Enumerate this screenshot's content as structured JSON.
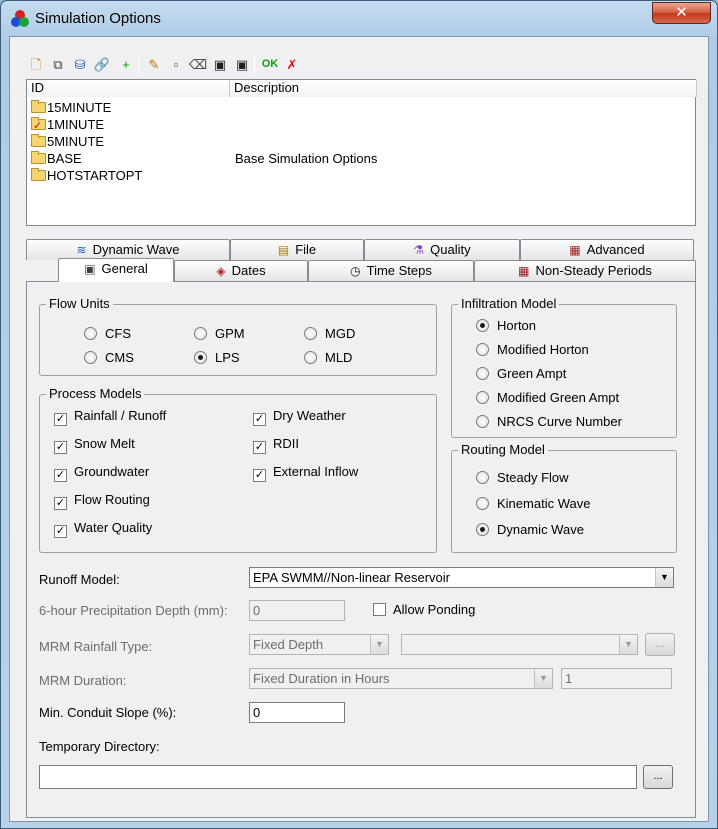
{
  "window": {
    "title": "Simulation Options",
    "close_label": "✕"
  },
  "toolbar": {
    "buttons": [
      {
        "name": "new-icon",
        "glyph": "🗋",
        "color": "#c08000"
      },
      {
        "name": "copy-icon",
        "glyph": "⧉",
        "color": "#404040"
      },
      {
        "name": "database-icon",
        "glyph": "⛁",
        "color": "#2060c0"
      },
      {
        "name": "link-icon",
        "glyph": "🔗",
        "color": "#404040"
      },
      {
        "name": "add-item-icon",
        "glyph": "+",
        "color": "#10a010"
      },
      {
        "name": "edit-pencil-icon",
        "glyph": "✎",
        "color": "#c07000"
      },
      {
        "name": "edit-window-icon",
        "glyph": "▫",
        "color": "#404040"
      },
      {
        "name": "eraser-icon",
        "glyph": "⌫",
        "color": "#404040"
      },
      {
        "name": "save-icon",
        "glyph": "▣",
        "color": "#202020"
      },
      {
        "name": "save-as-icon",
        "glyph": "▣",
        "color": "#202020"
      },
      {
        "name": "ok-icon",
        "glyph": "OK",
        "color": "#10a010"
      },
      {
        "name": "cancel-icon",
        "glyph": "✗",
        "color": "#e01010"
      }
    ]
  },
  "list": {
    "columns": [
      "ID",
      "Description"
    ],
    "rows": [
      {
        "id": "15MINUTE",
        "description": "",
        "checked": false
      },
      {
        "id": "1MINUTE",
        "description": "",
        "checked": true
      },
      {
        "id": "5MINUTE",
        "description": "",
        "checked": false
      },
      {
        "id": "BASE",
        "description": "Base Simulation Options",
        "checked": false
      },
      {
        "id": "HOTSTARTOPT",
        "description": "",
        "checked": false
      }
    ]
  },
  "tabs": {
    "back_row": [
      {
        "label": "Dynamic Wave",
        "icon": "wave-icon",
        "glyph": "≋",
        "color": "#1a60c0"
      },
      {
        "label": "File",
        "icon": "file-icon",
        "glyph": "▤",
        "color": "#b08000"
      },
      {
        "label": "Quality",
        "icon": "flask-icon",
        "glyph": "⚗",
        "color": "#8040c0"
      },
      {
        "label": "Advanced",
        "icon": "toolbox-icon",
        "glyph": "▦",
        "color": "#a02020"
      }
    ],
    "front_row": [
      {
        "label": "General",
        "icon": "general-icon",
        "glyph": "▣",
        "color": "#404040",
        "active": true
      },
      {
        "label": "Dates",
        "icon": "calendar-icon",
        "glyph": "◈",
        "color": "#b02020",
        "active": false
      },
      {
        "label": "Time Steps",
        "icon": "clock-icon",
        "glyph": "◷",
        "color": "#202020",
        "active": false
      },
      {
        "label": "Non-Steady Periods",
        "icon": "periods-icon",
        "glyph": "▦",
        "color": "#902020",
        "active": false
      }
    ]
  },
  "general": {
    "flow_units": {
      "title": "Flow Units",
      "options": [
        "CFS",
        "GPM",
        "MGD",
        "CMS",
        "LPS",
        "MLD"
      ],
      "selected": "LPS"
    },
    "process_models": {
      "title": "Process Models",
      "items": [
        {
          "label": "Rainfall / Runoff",
          "checked": true
        },
        {
          "label": "Dry Weather",
          "checked": true
        },
        {
          "label": "Snow Melt",
          "checked": true
        },
        {
          "label": "RDII",
          "checked": true
        },
        {
          "label": "Groundwater",
          "checked": true
        },
        {
          "label": "External Inflow",
          "checked": true
        },
        {
          "label": "Flow Routing",
          "checked": true
        },
        {
          "label": "Water Quality",
          "checked": true
        }
      ]
    },
    "infiltration": {
      "title": "Infiltration Model",
      "options": [
        "Horton",
        "Modified Horton",
        "Green Ampt",
        "Modified Green Ampt",
        "NRCS Curve Number"
      ],
      "selected": "Horton"
    },
    "routing": {
      "title": "Routing Model",
      "options": [
        "Steady Flow",
        "Kinematic Wave",
        "Dynamic Wave"
      ],
      "selected": "Dynamic Wave"
    },
    "runoff_model": {
      "label": "Runoff Model:",
      "value": "EPA SWMM//Non-linear Reservoir"
    },
    "precip_depth": {
      "label": "6-hour Precipitation Depth (mm):",
      "value": "0"
    },
    "allow_ponding": {
      "label": "Allow Ponding",
      "checked": false
    },
    "mrm_rainfall": {
      "label": "MRM Rainfall Type:",
      "value": "Fixed Depth",
      "value2": "",
      "button": "..."
    },
    "mrm_duration": {
      "label": "MRM Duration:",
      "value": "Fixed Duration in Hours",
      "value2": "1"
    },
    "min_slope": {
      "label": "Min. Conduit Slope (%):",
      "value": "0"
    },
    "temp_dir": {
      "label": "Temporary Directory:",
      "value": "",
      "button": "..."
    }
  }
}
